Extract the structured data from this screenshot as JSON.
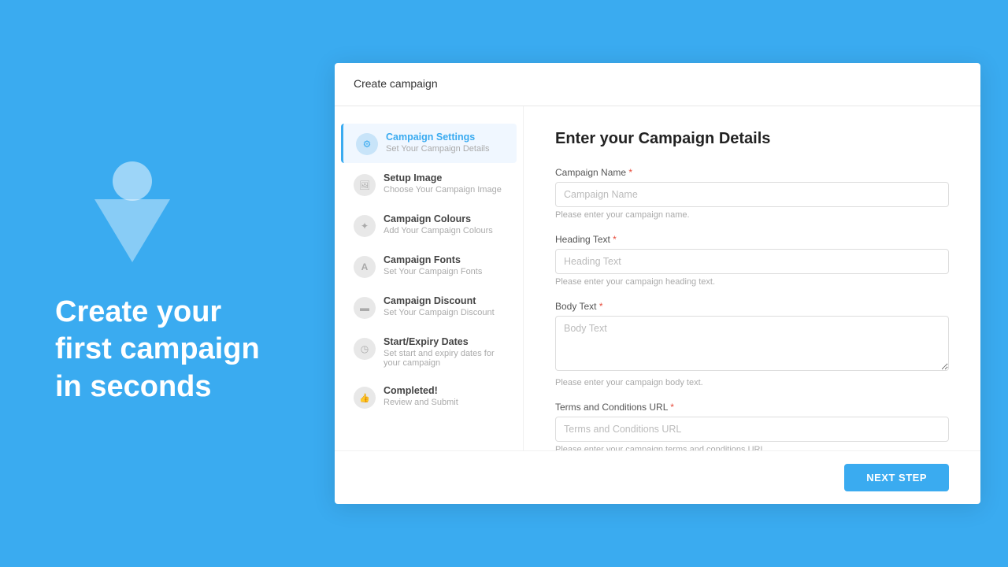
{
  "background_color": "#3aabf0",
  "left_panel": {
    "hero_text": "Create your\nfirst campaign\nin seconds"
  },
  "card": {
    "title": "Create campaign",
    "form_heading": "Enter your Campaign Details",
    "steps": [
      {
        "id": "campaign-settings",
        "name": "Campaign Settings",
        "desc": "Set Your Campaign Details",
        "icon": "settings-icon",
        "active": true
      },
      {
        "id": "setup-image",
        "name": "Setup Image",
        "desc": "Choose Your Campaign Image",
        "icon": "image-icon",
        "active": false
      },
      {
        "id": "campaign-colours",
        "name": "Campaign Colours",
        "desc": "Add Your Campaign Colours",
        "icon": "colors-icon",
        "active": false
      },
      {
        "id": "campaign-fonts",
        "name": "Campaign Fonts",
        "desc": "Set Your Campaign Fonts",
        "icon": "fonts-icon",
        "active": false
      },
      {
        "id": "campaign-discount",
        "name": "Campaign Discount",
        "desc": "Set Your Campaign Discount",
        "icon": "discount-icon",
        "active": false
      },
      {
        "id": "start-expiry-dates",
        "name": "Start/Expiry Dates",
        "desc": "Set start and expiry dates for your campaign",
        "icon": "dates-icon",
        "active": false
      },
      {
        "id": "completed",
        "name": "Completed!",
        "desc": "Review and Submit",
        "icon": "complete-icon",
        "active": false
      }
    ],
    "fields": [
      {
        "id": "campaign-name",
        "label": "Campaign Name",
        "required": true,
        "placeholder": "Campaign Name",
        "hint": "Please enter your campaign name.",
        "type": "text"
      },
      {
        "id": "heading-text",
        "label": "Heading Text",
        "required": true,
        "placeholder": "Heading Text",
        "hint": "Please enter your campaign heading text.",
        "type": "text"
      },
      {
        "id": "body-text",
        "label": "Body Text",
        "required": true,
        "placeholder": "Body Text",
        "hint": "Please enter your campaign body text.",
        "type": "textarea"
      },
      {
        "id": "terms-url",
        "label": "Terms and Conditions URL",
        "required": true,
        "placeholder": "Terms and Conditions URL",
        "hint": "Please enter your campaign terms and conditions URL.",
        "type": "text"
      }
    ],
    "next_button_label": "NEXT STEP"
  }
}
